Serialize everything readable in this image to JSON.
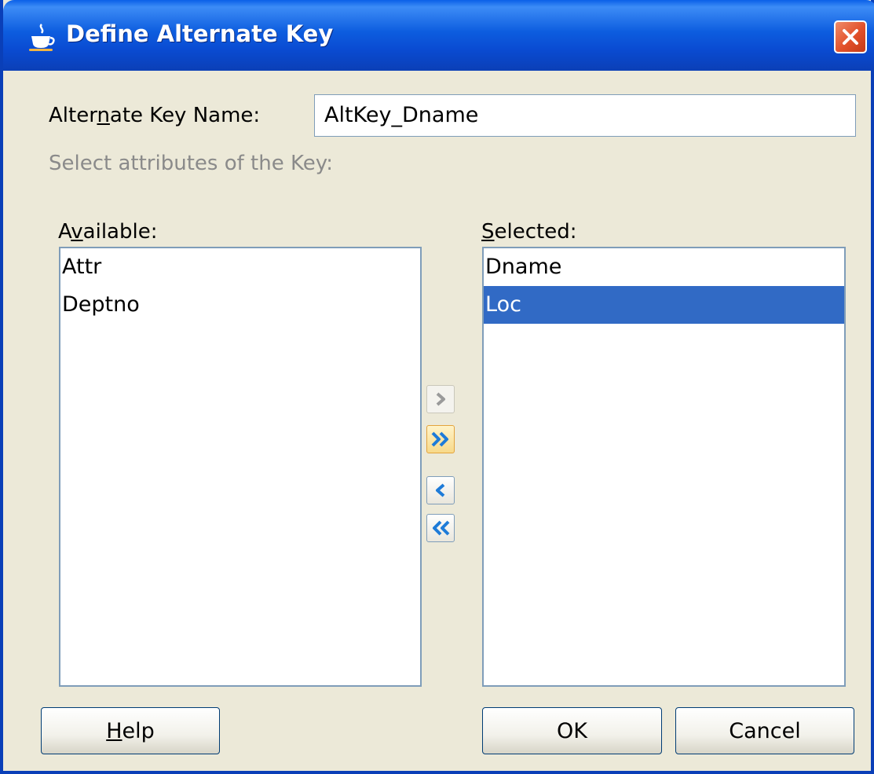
{
  "window": {
    "title": "Define Alternate Key"
  },
  "form": {
    "name_label_pre": "Alter",
    "name_label_mnemonic": "n",
    "name_label_post": "ate Key Name:",
    "name_value": "AltKey_Dname",
    "select_hint": "Select attributes of the Key:"
  },
  "available": {
    "label_pre": "A",
    "label_mnemonic": "v",
    "label_post": "ailable:",
    "items": [
      "Attr",
      "Deptno"
    ]
  },
  "selected": {
    "label_mnemonic": "S",
    "label_post": "elected:",
    "items": [
      "Dname",
      "Loc"
    ],
    "selected_item": "Loc"
  },
  "shuttle": {
    "add": "add-icon",
    "add_all": "add-all-icon",
    "remove": "remove-icon",
    "remove_all": "remove-all-icon"
  },
  "buttons": {
    "help_mnemonic": "H",
    "help_post": "elp",
    "ok": "OK",
    "cancel": "Cancel"
  },
  "colors": {
    "titlebar": "#0a4bd2",
    "selection": "#316ac5",
    "close": "#e2502a"
  }
}
